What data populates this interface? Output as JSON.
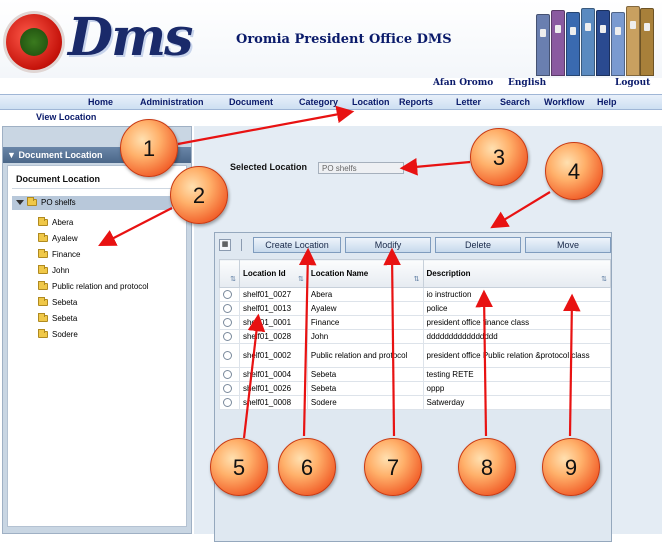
{
  "header": {
    "logo_text": "Dms",
    "app_title": "Oromia President Office DMS",
    "top_links": [
      "Afan Oromo",
      "English",
      "Logout"
    ]
  },
  "nav": {
    "items": [
      "Home",
      "Administration",
      "Document",
      "Category",
      "Location",
      "Reports",
      "Letter",
      "Search",
      "Workflow",
      "Help"
    ],
    "sub_item": "View Location"
  },
  "left_panel": {
    "header": "Document Location",
    "title": "Document Location",
    "tree_root": "PO shelfs",
    "tree_children": [
      "Abera",
      "Ayalew",
      "Finance",
      "John",
      "Public relation and protocol",
      "Sebeta",
      "Sebeta",
      "Sodere"
    ]
  },
  "selected_location": {
    "label": "Selected Location",
    "value": "PO shelfs"
  },
  "toolbar": {
    "create_label": "Create Location",
    "modify_label": "Modify",
    "delete_label": "Delete",
    "move_label": "Move"
  },
  "table": {
    "headers": [
      "Location Id",
      "Location Name",
      "Description"
    ],
    "rows": [
      {
        "id": "shelf01_0027",
        "name": "Abera",
        "desc": "io instruction"
      },
      {
        "id": "shelf01_0013",
        "name": "Ayalew",
        "desc": "police"
      },
      {
        "id": "shelf01_0001",
        "name": "Finance",
        "desc": "president office finance class"
      },
      {
        "id": "shelf01_0028",
        "name": "John",
        "desc": "dddddddddddddddd"
      },
      {
        "id": "shelf01_0002",
        "name": "Public relation and protocol",
        "desc": "president office Public relation &protocol class"
      },
      {
        "id": "shelf01_0004",
        "name": "Sebeta",
        "desc": "testing RETE"
      },
      {
        "id": "shelf01_0026",
        "name": "Sebeta",
        "desc": "oppp"
      },
      {
        "id": "shelf01_0008",
        "name": "Sodere",
        "desc": "Satwerday"
      }
    ]
  },
  "annotations": [
    "1",
    "2",
    "3",
    "4",
    "5",
    "6",
    "7",
    "8",
    "9"
  ],
  "colors": {
    "nav_text": "#0a1a6a",
    "panel_header": "#4a6688",
    "bubble": "#f2622c",
    "arrow": "#e81212"
  }
}
